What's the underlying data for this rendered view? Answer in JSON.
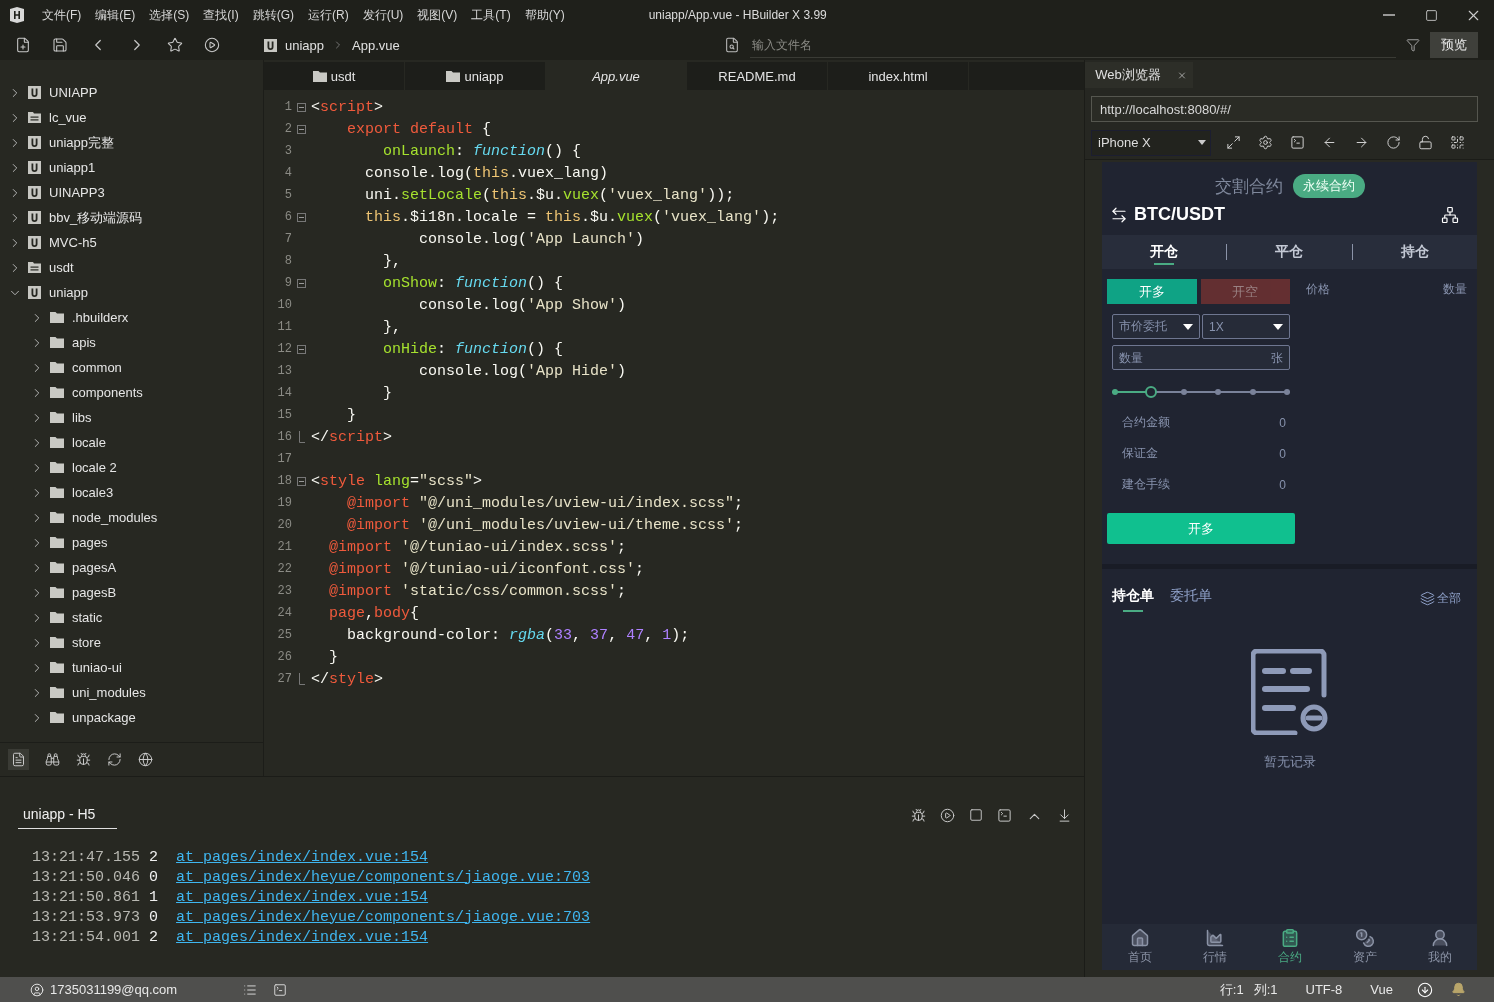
{
  "window": {
    "title": "uniapp/App.vue - HBuilder X 3.99",
    "menu": [
      "文件(F)",
      "编辑(E)",
      "选择(S)",
      "查找(I)",
      "跳转(G)",
      "运行(R)",
      "发行(U)",
      "视图(V)",
      "工具(T)",
      "帮助(Y)"
    ]
  },
  "toolbar": {
    "breadcrumb": [
      "uniapp",
      "App.vue"
    ],
    "search": {
      "placeholder": "输入文件名"
    },
    "preview_button": "预览"
  },
  "sidebar": {
    "items": [
      {
        "label": "UNIAPP",
        "kind": "project",
        "expanded": false
      },
      {
        "label": "lc_vue",
        "kind": "folder",
        "expanded": false
      },
      {
        "label": "uniapp完整",
        "kind": "project",
        "expanded": false
      },
      {
        "label": "uniapp1",
        "kind": "project",
        "expanded": false
      },
      {
        "label": "UINAPP3",
        "kind": "project",
        "expanded": false
      },
      {
        "label": "bbv_移动端源码",
        "kind": "project",
        "expanded": false
      },
      {
        "label": "MVC-h5",
        "kind": "project",
        "expanded": false
      },
      {
        "label": "usdt",
        "kind": "folder",
        "expanded": false
      },
      {
        "label": "uniapp",
        "kind": "project",
        "expanded": true,
        "children": [
          {
            "label": ".hbuilderx",
            "kind": "directory",
            "expanded": false
          },
          {
            "label": "apis",
            "kind": "directory",
            "expanded": false
          },
          {
            "label": "common",
            "kind": "directory",
            "expanded": false
          },
          {
            "label": "components",
            "kind": "directory",
            "expanded": false
          },
          {
            "label": "libs",
            "kind": "directory",
            "expanded": false
          },
          {
            "label": "locale",
            "kind": "directory",
            "expanded": false
          },
          {
            "label": "locale 2",
            "kind": "directory",
            "expanded": false
          },
          {
            "label": "locale3",
            "kind": "directory",
            "expanded": false
          },
          {
            "label": "node_modules",
            "kind": "directory",
            "expanded": false
          },
          {
            "label": "pages",
            "kind": "directory",
            "expanded": false
          },
          {
            "label": "pagesA",
            "kind": "directory",
            "expanded": false
          },
          {
            "label": "pagesB",
            "kind": "directory",
            "expanded": false
          },
          {
            "label": "static",
            "kind": "directory",
            "expanded": false
          },
          {
            "label": "store",
            "kind": "directory",
            "expanded": false
          },
          {
            "label": "tuniao-ui",
            "kind": "directory",
            "expanded": false
          },
          {
            "label": "uni_modules",
            "kind": "directory",
            "expanded": false
          },
          {
            "label": "unpackage",
            "kind": "directory",
            "expanded": false
          }
        ]
      }
    ]
  },
  "editor": {
    "tabs": [
      {
        "label": "usdt",
        "kind": "folder",
        "selected": false
      },
      {
        "label": "uniapp",
        "kind": "folder",
        "selected": false
      },
      {
        "label": "App.vue",
        "kind": "file",
        "selected": true
      },
      {
        "label": "README.md",
        "kind": "file",
        "selected": false
      },
      {
        "label": "index.html",
        "kind": "file",
        "selected": false
      }
    ],
    "lines": [
      {
        "number": "1",
        "kind": "fold_start",
        "tokens": [
          {
            "text": "<",
            "kind": "plain"
          },
          {
            "text": "script",
            "kind": "tag"
          },
          {
            "text": ">",
            "kind": "plain"
          }
        ]
      },
      {
        "number": "2",
        "kind": "fold_start",
        "tokens": [
          {
            "text": "    export default",
            "kind": "tag"
          },
          {
            "text": " {",
            "kind": "plain"
          }
        ]
      },
      {
        "number": "3",
        "kind": "plain",
        "tokens": [
          {
            "text": "        onLaunch",
            "kind": "prop"
          },
          {
            "text": ": ",
            "kind": "plain"
          },
          {
            "text": "function",
            "kind": "fn"
          },
          {
            "text": "() {",
            "kind": "plain"
          }
        ]
      },
      {
        "number": "4",
        "kind": "plain",
        "tokens": [
          {
            "text": "      console.log(",
            "kind": "plain"
          },
          {
            "text": "this",
            "kind": "this"
          },
          {
            "text": ".vuex_lang)",
            "kind": "plain"
          }
        ]
      },
      {
        "number": "5",
        "kind": "plain",
        "tokens": [
          {
            "text": "      uni.",
            "kind": "plain"
          },
          {
            "text": "setLocale",
            "kind": "prop"
          },
          {
            "text": "(",
            "kind": "plain"
          },
          {
            "text": "this",
            "kind": "this"
          },
          {
            "text": ".$u.",
            "kind": "plain"
          },
          {
            "text": "vuex",
            "kind": "prop"
          },
          {
            "text": "(",
            "kind": "plain"
          },
          {
            "text": "'vuex_lang'",
            "kind": "str"
          },
          {
            "text": "));",
            "kind": "plain"
          }
        ]
      },
      {
        "number": "6",
        "kind": "fold_start",
        "tokens": [
          {
            "text": "      this",
            "kind": "this"
          },
          {
            "text": ".$i18n.locale = ",
            "kind": "plain"
          },
          {
            "text": "this",
            "kind": "this"
          },
          {
            "text": ".$u.",
            "kind": "plain"
          },
          {
            "text": "vuex",
            "kind": "prop"
          },
          {
            "text": "(",
            "kind": "plain"
          },
          {
            "text": "'vuex_lang'",
            "kind": "str"
          },
          {
            "text": ");",
            "kind": "plain"
          }
        ]
      },
      {
        "number": "7",
        "kind": "plain",
        "tokens": [
          {
            "text": "            console.log(",
            "kind": "plain"
          },
          {
            "text": "'App Launch'",
            "kind": "str"
          },
          {
            "text": ")",
            "kind": "plain"
          }
        ]
      },
      {
        "number": "8",
        "kind": "plain",
        "tokens": [
          {
            "text": "        },",
            "kind": "plain"
          }
        ]
      },
      {
        "number": "9",
        "kind": "fold_start",
        "tokens": [
          {
            "text": "        onShow",
            "kind": "prop"
          },
          {
            "text": ": ",
            "kind": "plain"
          },
          {
            "text": "function",
            "kind": "fn"
          },
          {
            "text": "() {",
            "kind": "plain"
          }
        ]
      },
      {
        "number": "10",
        "kind": "plain",
        "tokens": [
          {
            "text": "            console.log(",
            "kind": "plain"
          },
          {
            "text": "'App Show'",
            "kind": "str"
          },
          {
            "text": ")",
            "kind": "plain"
          }
        ]
      },
      {
        "number": "11",
        "kind": "plain",
        "tokens": [
          {
            "text": "        },",
            "kind": "plain"
          }
        ]
      },
      {
        "number": "12",
        "kind": "fold_start",
        "tokens": [
          {
            "text": "        onHide",
            "kind": "prop"
          },
          {
            "text": ": ",
            "kind": "plain"
          },
          {
            "text": "function",
            "kind": "fn"
          },
          {
            "text": "() {",
            "kind": "plain"
          }
        ]
      },
      {
        "number": "13",
        "kind": "plain",
        "tokens": [
          {
            "text": "            console.log(",
            "kind": "plain"
          },
          {
            "text": "'App Hide'",
            "kind": "str"
          },
          {
            "text": ")",
            "kind": "plain"
          }
        ]
      },
      {
        "number": "14",
        "kind": "plain",
        "tokens": [
          {
            "text": "        }",
            "kind": "plain"
          }
        ]
      },
      {
        "number": "15",
        "kind": "plain",
        "tokens": [
          {
            "text": "    }",
            "kind": "plain"
          }
        ]
      },
      {
        "number": "16",
        "kind": "fold_end",
        "tokens": [
          {
            "text": "</",
            "kind": "plain"
          },
          {
            "text": "script",
            "kind": "tag"
          },
          {
            "text": ">",
            "kind": "plain"
          }
        ]
      },
      {
        "number": "17",
        "kind": "plain"
      },
      {
        "number": "18",
        "kind": "fold_start",
        "tokens": [
          {
            "text": "<",
            "kind": "plain"
          },
          {
            "text": "style",
            "kind": "tag"
          },
          {
            "text": " lang",
            "kind": "prop"
          },
          {
            "text": "=",
            "kind": "plain"
          },
          {
            "text": "\"scss\"",
            "kind": "str"
          },
          {
            "text": ">",
            "kind": "plain"
          }
        ]
      },
      {
        "number": "19",
        "kind": "plain",
        "tokens": [
          {
            "text": "    @import",
            "kind": "tag"
          },
          {
            "text": " \"@/uni_modules/uview-ui/index.scss\"",
            "kind": "str"
          },
          {
            "text": ";",
            "kind": "plain"
          }
        ]
      },
      {
        "number": "20",
        "kind": "plain",
        "tokens": [
          {
            "text": "    @import",
            "kind": "tag"
          },
          {
            "text": " '@/uni_modules/uview-ui/theme.scss'",
            "kind": "str"
          },
          {
            "text": ";",
            "kind": "plain"
          }
        ]
      },
      {
        "number": "21",
        "kind": "plain",
        "tokens": [
          {
            "text": "  @import",
            "kind": "tag"
          },
          {
            "text": " '@/tuniao-ui/index.scss'",
            "kind": "str"
          },
          {
            "text": ";",
            "kind": "plain"
          }
        ]
      },
      {
        "number": "22",
        "kind": "plain",
        "tokens": [
          {
            "text": "  @import",
            "kind": "tag"
          },
          {
            "text": " '@/tuniao-ui/iconfont.css'",
            "kind": "str"
          },
          {
            "text": ";",
            "kind": "plain"
          }
        ]
      },
      {
        "number": "23",
        "kind": "plain",
        "tokens": [
          {
            "text": "  @import",
            "kind": "tag"
          },
          {
            "text": " 'static/css/common.scss'",
            "kind": "str"
          },
          {
            "text": ";",
            "kind": "plain"
          }
        ]
      },
      {
        "number": "24",
        "kind": "plain",
        "tokens": [
          {
            "text": "  page",
            "kind": "tag"
          },
          {
            "text": ",",
            "kind": "plain"
          },
          {
            "text": "body",
            "kind": "tag"
          },
          {
            "text": "{",
            "kind": "plain"
          }
        ]
      },
      {
        "number": "25",
        "kind": "plain",
        "tokens": [
          {
            "text": "    background-color: ",
            "kind": "plain"
          },
          {
            "text": "rgba",
            "kind": "fn"
          },
          {
            "text": "(",
            "kind": "plain"
          },
          {
            "text": "33",
            "kind": "num"
          },
          {
            "text": ", ",
            "kind": "plain"
          },
          {
            "text": "37",
            "kind": "num"
          },
          {
            "text": ", ",
            "kind": "plain"
          },
          {
            "text": "47",
            "kind": "num"
          },
          {
            "text": ", ",
            "kind": "plain"
          },
          {
            "text": "1",
            "kind": "num"
          },
          {
            "text": ");",
            "kind": "plain"
          }
        ]
      },
      {
        "number": "26",
        "kind": "plain",
        "tokens": [
          {
            "text": "  }",
            "kind": "plain"
          }
        ]
      },
      {
        "number": "27",
        "kind": "fold_end",
        "tokens": [
          {
            "text": "</",
            "kind": "plain"
          },
          {
            "text": "style",
            "kind": "tag"
          },
          {
            "text": ">",
            "kind": "plain"
          }
        ]
      }
    ]
  },
  "console": {
    "tab": "uniapp - H5",
    "rows": [
      {
        "time": "13:21:47.155",
        "count": "2",
        "link": "at pages/index/index.vue:154"
      },
      {
        "time": "13:21:50.046",
        "count": "0",
        "link": "at pages/index/heyue/components/jiaoge.vue:703"
      },
      {
        "time": "13:21:50.861",
        "count": "1",
        "link": "at pages/index/index.vue:154"
      },
      {
        "time": "13:21:53.973",
        "count": "0",
        "link": "at pages/index/heyue/components/jiaoge.vue:703"
      },
      {
        "time": "13:21:54.001",
        "count": "2",
        "link": "at pages/index/index.vue:154"
      }
    ]
  },
  "browser": {
    "tab": "Web浏览器",
    "url": "http://localhost:8080/#/",
    "device": "iPhone X",
    "app": {
      "contract_tabs": [
        {
          "label": "交割合约",
          "selected": false
        },
        {
          "label": "永续合约",
          "selected": true
        }
      ],
      "pair": "BTC/USDT",
      "trade_tabs": [
        {
          "label": "开仓",
          "selected": true
        },
        {
          "label": "平仓",
          "selected": false
        },
        {
          "label": "持仓",
          "selected": false
        }
      ],
      "sides": [
        {
          "label": "开多",
          "kind": "buy",
          "selected": true
        },
        {
          "label": "开空",
          "kind": "sell",
          "selected": false
        }
      ],
      "book_headers": [
        "价格",
        "数量"
      ],
      "order_type": "市价委托",
      "leverage": "1X",
      "amount": {
        "placeholder": "数量",
        "unit": "张"
      },
      "slider": {
        "level": 0.2
      },
      "summary": [
        {
          "label": "合约金额",
          "value": "0"
        },
        {
          "label": "保证金",
          "value": "0"
        },
        {
          "label": "建仓手续",
          "value": "0"
        }
      ],
      "submit": "开多",
      "order_tabs": [
        {
          "label": "持仓单",
          "selected": true
        },
        {
          "label": "委托单",
          "selected": false
        }
      ],
      "filter": "全部",
      "empty": "暂无记录",
      "nav": [
        {
          "label": "首页",
          "kind": "home",
          "selected": false
        },
        {
          "label": "行情",
          "kind": "market",
          "selected": false
        },
        {
          "label": "合约",
          "kind": "contract",
          "selected": true
        },
        {
          "label": "资产",
          "kind": "assets",
          "selected": false
        },
        {
          "label": "我的",
          "kind": "profile",
          "selected": false
        }
      ]
    }
  },
  "status_bar": {
    "user": "1735031199@qq.com",
    "line": "行:1",
    "column": "列:1",
    "encoding": "UTF-8",
    "language": "Vue"
  }
}
